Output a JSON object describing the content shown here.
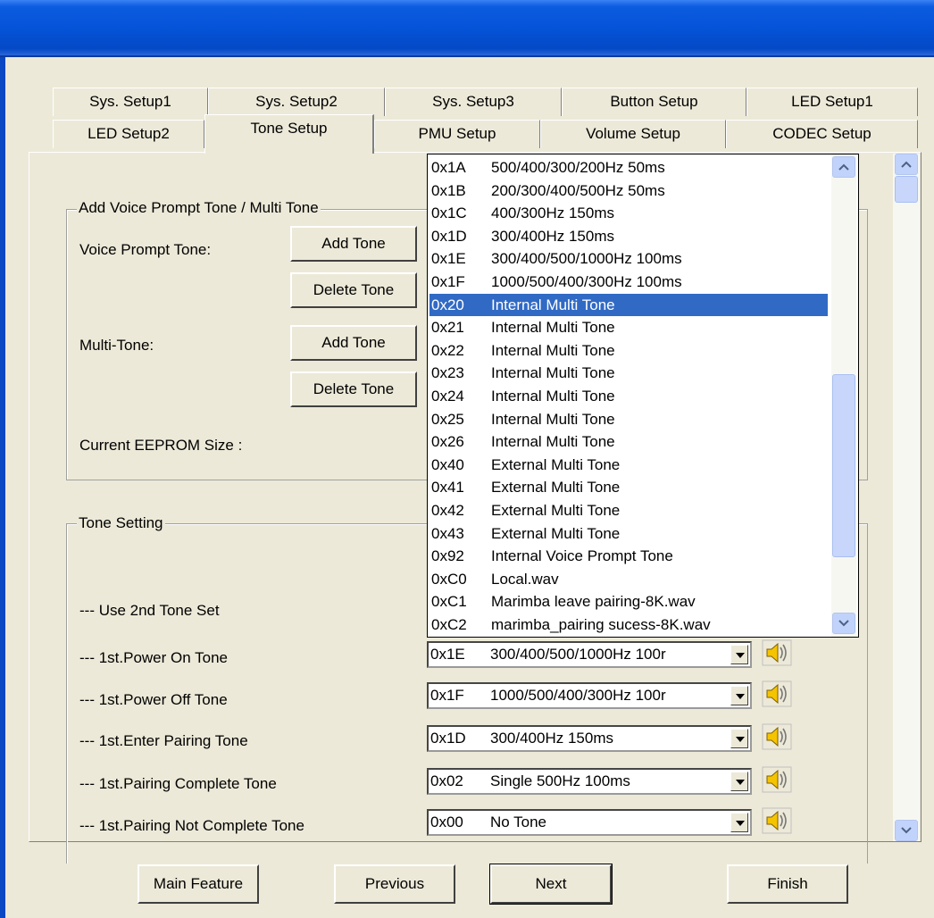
{
  "tabs_row1": [
    "Sys. Setup1",
    "Sys. Setup2",
    "Sys. Setup3",
    "Button Setup",
    "LED Setup1"
  ],
  "tabs_row2": [
    "LED Setup2",
    "Tone Setup",
    "PMU Setup",
    "Volume Setup",
    "CODEC Setup"
  ],
  "selected_tab": "Tone Setup",
  "group1": {
    "title": "Add Voice Prompt Tone /  Multi Tone",
    "voice_prompt_label": "Voice Prompt Tone:",
    "multi_tone_label": "Multi-Tone:",
    "add_tone": "Add Tone",
    "delete_tone": "Delete Tone",
    "eeprom_label": "Current EEPROM Size :"
  },
  "group2": {
    "title": "Tone Setting",
    "rows": [
      {
        "label": "--- Use 2nd Tone Set"
      },
      {
        "label": "--- 1st.Power On Tone",
        "code": "0x1E",
        "value": "300/400/500/1000Hz 100r"
      },
      {
        "label": "--- 1st.Power Off Tone",
        "code": "0x1F",
        "value": "1000/500/400/300Hz 100r"
      },
      {
        "label": "--- 1st.Enter Pairing Tone",
        "code": "0x1D",
        "value": "300/400Hz 150ms"
      },
      {
        "label": "--- 1st.Pairing Complete Tone",
        "code": "0x02",
        "value": "Single 500Hz  100ms"
      },
      {
        "label": "--- 1st.Pairing Not Complete Tone",
        "code": "0x00",
        "value": "No Tone"
      }
    ]
  },
  "dropdown": {
    "selected_index": 6,
    "scroll_position": 0.78,
    "items": [
      {
        "code": "0x1A",
        "text": "500/400/300/200Hz 50ms"
      },
      {
        "code": "0x1B",
        "text": "200/300/400/500Hz 50ms"
      },
      {
        "code": "0x1C",
        "text": "400/300Hz 150ms"
      },
      {
        "code": "0x1D",
        "text": "300/400Hz 150ms"
      },
      {
        "code": "0x1E",
        "text": "300/400/500/1000Hz 100ms"
      },
      {
        "code": "0x1F",
        "text": "1000/500/400/300Hz 100ms"
      },
      {
        "code": "0x20",
        "text": "Internal Multi Tone"
      },
      {
        "code": "0x21",
        "text": "Internal Multi Tone"
      },
      {
        "code": "0x22",
        "text": "Internal Multi Tone"
      },
      {
        "code": "0x23",
        "text": "Internal Multi Tone"
      },
      {
        "code": "0x24",
        "text": "Internal Multi Tone"
      },
      {
        "code": "0x25",
        "text": "Internal Multi Tone"
      },
      {
        "code": "0x26",
        "text": "Internal Multi Tone"
      },
      {
        "code": "0x40",
        "text": "External Multi Tone"
      },
      {
        "code": "0x41",
        "text": "External Multi Tone"
      },
      {
        "code": "0x42",
        "text": "External Multi Tone"
      },
      {
        "code": "0x43",
        "text": "External Multi Tone"
      },
      {
        "code": "0x92",
        "text": "Internal Voice Prompt Tone"
      },
      {
        "code": "0xC0",
        "text": "Local.wav"
      },
      {
        "code": "0xC1",
        "text": "Marimba leave pairing-8K.wav"
      },
      {
        "code": "0xC2",
        "text": "marimba_pairing sucess-8K.wav"
      }
    ]
  },
  "footer": {
    "main_feature": "Main Feature",
    "previous": "Previous",
    "next": "Next",
    "finish": "Finish"
  },
  "colors": {
    "titlebar": "#0553d8",
    "selection": "#316ac5",
    "window": "#ece9d8"
  },
  "icons": {
    "speaker": "speaker-icon"
  }
}
